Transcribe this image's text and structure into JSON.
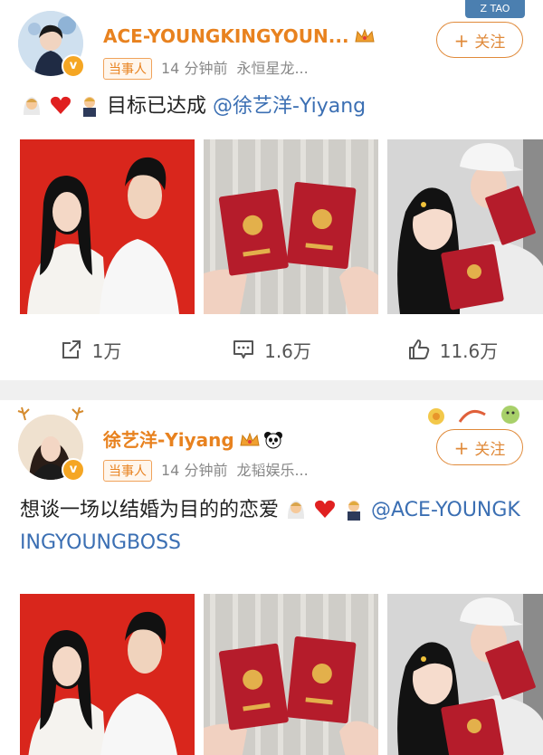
{
  "posts": [
    {
      "username": "ACE-YOUNGKINGYOUN...",
      "tag": "当事人",
      "time": "14 分钟前",
      "source": "永恒星龙...",
      "follow_label": "关注",
      "follow_plus": "+",
      "deco_label": "Z TAO",
      "content_text": "目标已达成 ",
      "mention": "@徐艺洋-Yiyang",
      "actions": {
        "repost": "1万",
        "comment": "1.6万",
        "like": "11.6万"
      }
    },
    {
      "username": "徐艺洋-Yiyang",
      "tag": "当事人",
      "time": "14 分钟前",
      "source": "龙韬娱乐...",
      "follow_label": "关注",
      "follow_plus": "+",
      "content_text": "想谈一场以结婚为目的的恋爱",
      "mention": "@ACE-YOUNGKINGYOUNGBOSS"
    }
  ],
  "icons": {
    "verified": "v",
    "repost": "share-icon",
    "comment": "comment-icon",
    "like": "thumbs-up-icon"
  },
  "colors": {
    "username": "#e8821f",
    "mention": "#3b6fb3",
    "certificate": "#b51c2b",
    "photo_bg": "#d9261c"
  }
}
